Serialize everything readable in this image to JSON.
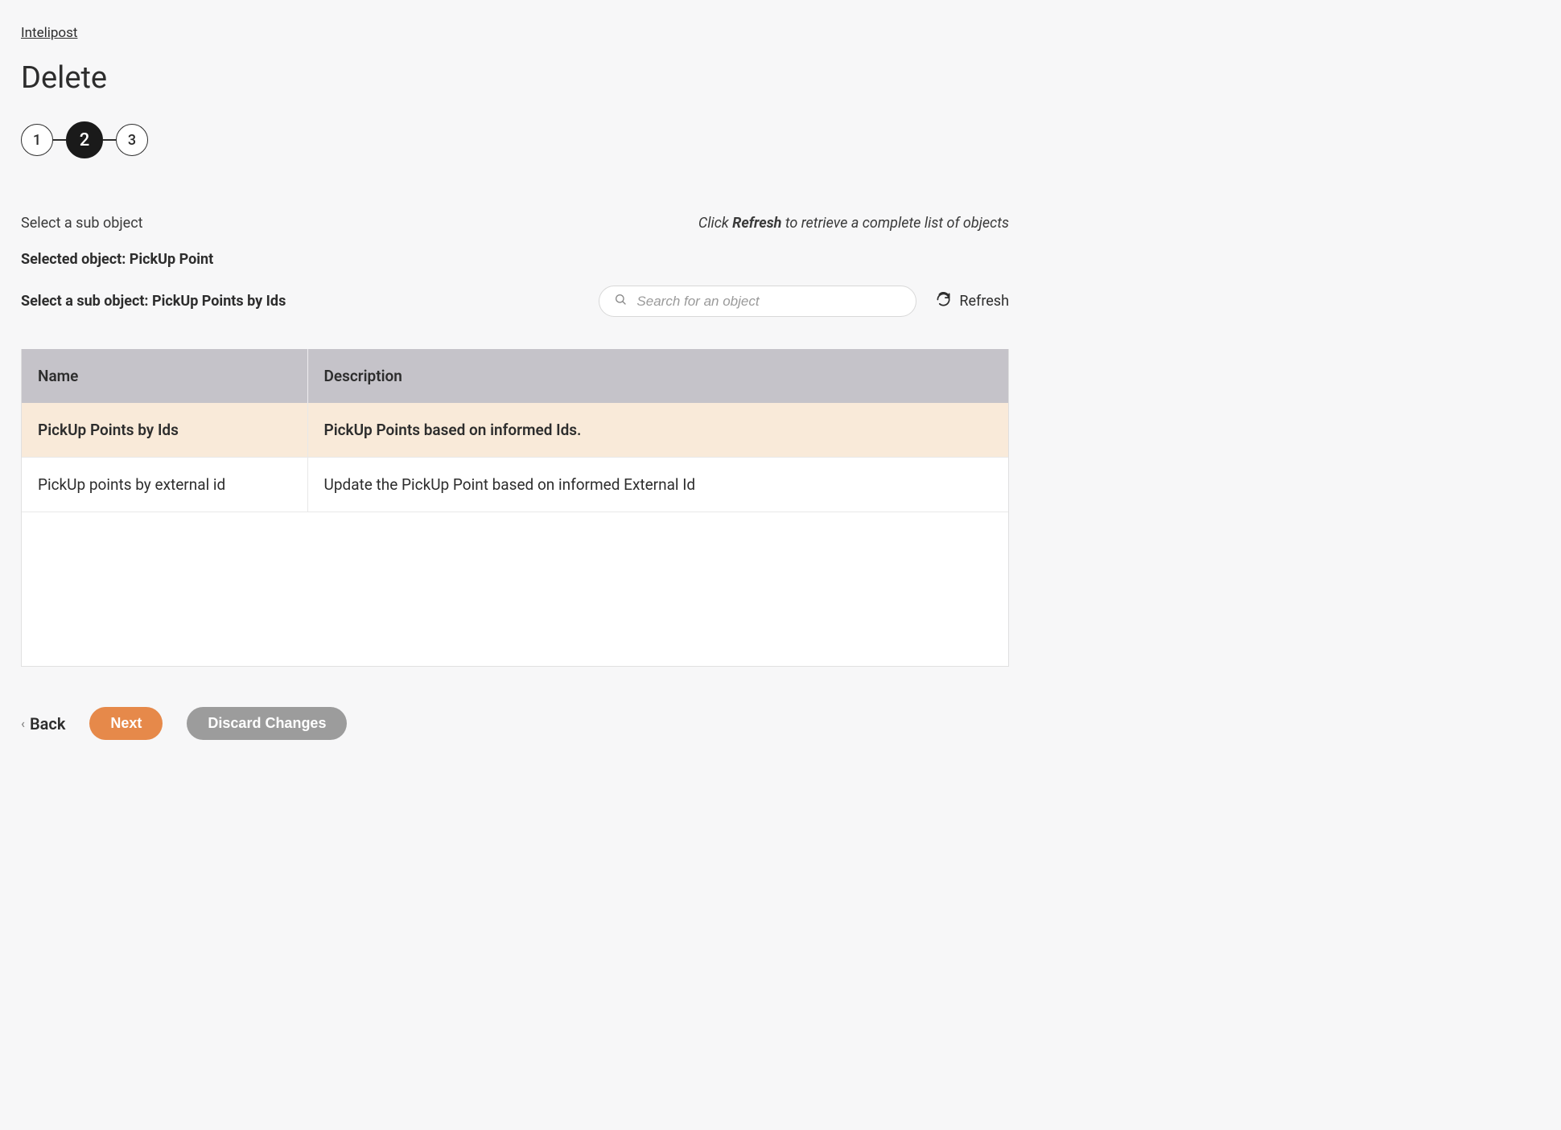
{
  "breadcrumb": "Intelipost",
  "pageTitle": "Delete",
  "stepper": {
    "steps": [
      "1",
      "2",
      "3"
    ],
    "activeIndex": 1
  },
  "subheader": {
    "left": "Select a sub object",
    "rightPrefix": "Click ",
    "rightBold": "Refresh",
    "rightSuffix": " to retrieve a complete list of objects"
  },
  "selection": {
    "selectedObjectLabel": "Selected object: PickUp Point",
    "selectSubObjectLabel": "Select a sub object: PickUp Points by Ids"
  },
  "search": {
    "placeholder": "Search for an object"
  },
  "refreshLabel": "Refresh",
  "table": {
    "columns": [
      "Name",
      "Description"
    ],
    "rows": [
      {
        "name": "PickUp Points by Ids",
        "description": "PickUp Points based on informed Ids.",
        "selected": true
      },
      {
        "name": "PickUp points by external id",
        "description": "Update the PickUp Point based on informed External Id",
        "selected": false
      }
    ]
  },
  "footer": {
    "back": "Back",
    "next": "Next",
    "discard": "Discard Changes"
  }
}
